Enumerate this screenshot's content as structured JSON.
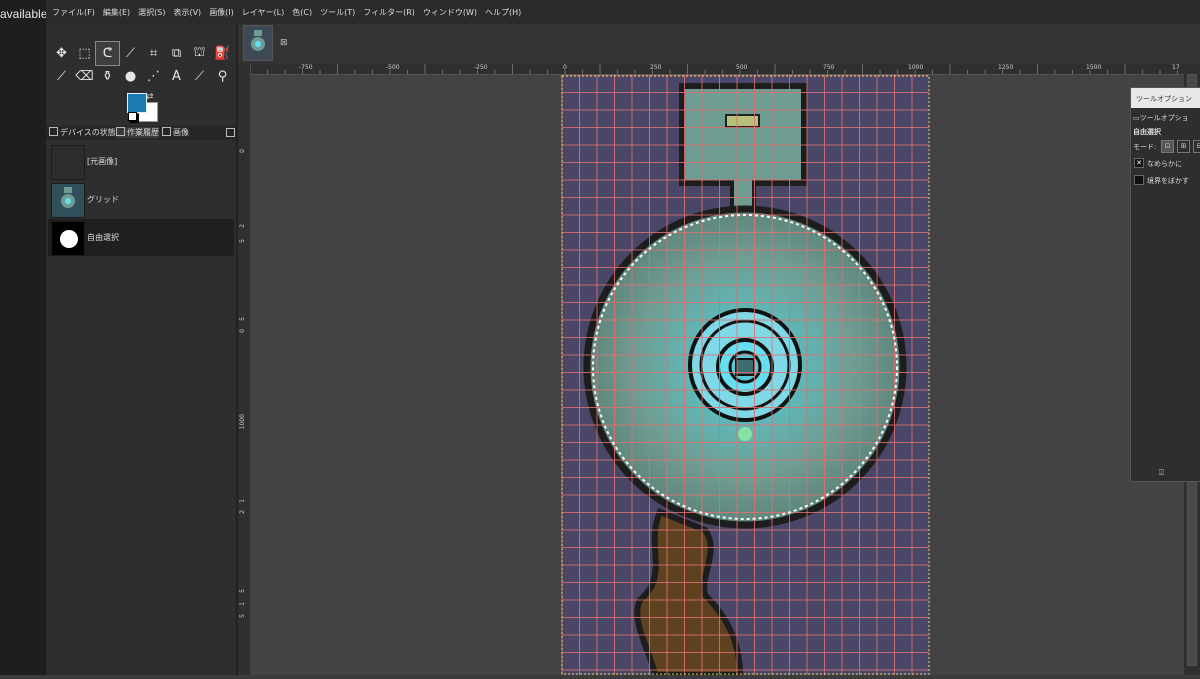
{
  "left_strip": {
    "text": "available"
  },
  "menu": [
    "ファイル(F)",
    "編集(E)",
    "選択(S)",
    "表示(V)",
    "画像(I)",
    "レイヤー(L)",
    "色(C)",
    "ツール(T)",
    "フィルター(R)",
    "ウィンドウ(W)",
    "ヘルプ(H)"
  ],
  "toolbox": {
    "tools": [
      {
        "icon": "move-tool-icon",
        "glyph": "✥"
      },
      {
        "icon": "rect-select-icon",
        "glyph": "⬚"
      },
      {
        "icon": "free-select-icon",
        "glyph": "ᕦ"
      },
      {
        "icon": "fuzzy-select-icon",
        "glyph": "⟋"
      },
      {
        "icon": "crop-icon",
        "glyph": "⌗"
      },
      {
        "icon": "transform-icon",
        "glyph": "⧉"
      },
      {
        "icon": "warp-icon",
        "glyph": "⛫"
      },
      {
        "icon": "bucket-fill-icon",
        "glyph": "⛽"
      },
      {
        "icon": "paintbrush-icon",
        "glyph": "⟋"
      },
      {
        "icon": "eraser-icon",
        "glyph": "⌫"
      },
      {
        "icon": "clone-icon",
        "glyph": "⚱"
      },
      {
        "icon": "smudge-icon",
        "glyph": "●"
      },
      {
        "icon": "path-icon",
        "glyph": "⋰"
      },
      {
        "icon": "text-tool-icon",
        "glyph": "A"
      },
      {
        "icon": "color-picker-icon",
        "glyph": "⟋"
      },
      {
        "icon": "zoom-icon",
        "glyph": "⚲"
      }
    ],
    "fg_color": "#1a7bb0",
    "bg_color": "#ffffff"
  },
  "dock_tabs": [
    "デバイスの状態",
    "作業履歴",
    "画像"
  ],
  "history": [
    {
      "label": "[元画像]",
      "thumb": "#2c2c2c"
    },
    {
      "label": "グリッド",
      "thumb": "#2f4f5a"
    },
    {
      "label": "自由選択",
      "thumb": "#000000"
    }
  ],
  "ruler": {
    "h_labels": [
      "-750",
      "-500",
      "-250",
      "0",
      "250",
      "500",
      "750",
      "1000",
      "1250",
      "1500",
      "17"
    ],
    "v_labels": [
      "0",
      "2",
      "5",
      "5",
      "0",
      "1000",
      "1",
      "2",
      "5",
      "1",
      "5"
    ]
  },
  "tool_options": {
    "title": "ツールオプション",
    "tab_label": "ツールオプショ",
    "tool_name": "自由選択",
    "mode_label": "モード:",
    "smooth_label": "なめらかに",
    "feather_label": "境界をぼかす",
    "smooth_checked": true,
    "feather_checked": false
  },
  "colors": {
    "map_bg": "#4a4668",
    "grid": "#e07070",
    "room": "#6f9c92",
    "glow": "#66e0f0",
    "path": "#5e4220"
  }
}
